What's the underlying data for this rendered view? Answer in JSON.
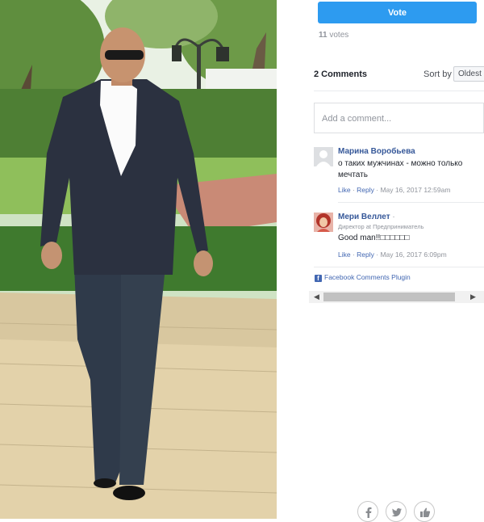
{
  "vote": {
    "button_label": "Vote",
    "count": "11",
    "count_label": "votes"
  },
  "comments_header": {
    "count_label": "2 Comments",
    "sort_label": "Sort by",
    "sort_value": "Oldest"
  },
  "comment_input": {
    "placeholder": "Add a comment..."
  },
  "comments": [
    {
      "name": "Марина Воробьева",
      "subtitle": "",
      "text": "о таких мужчинах - можно только мечтать",
      "like": "Like",
      "reply": "Reply",
      "timestamp": "May 16, 2017 12:59am"
    },
    {
      "name": "Мери Веллет",
      "subtitle": "Директор at Предприниматель",
      "text": "Good man!!□□□□□□",
      "like": "Like",
      "reply": "Reply",
      "timestamp": "May 16, 2017 6:09pm"
    }
  ],
  "plugin_label": "Facebook Comments Plugin",
  "icons": {
    "facebook": "facebook-icon",
    "twitter": "twitter-icon",
    "like": "thumbs-up-icon",
    "scroll_left": "chevron-left-icon",
    "scroll_right": "chevron-right-icon"
  },
  "colors": {
    "vote_button": "#2d9bf0",
    "link": "#365899",
    "facebook_blue": "#4267b2"
  }
}
